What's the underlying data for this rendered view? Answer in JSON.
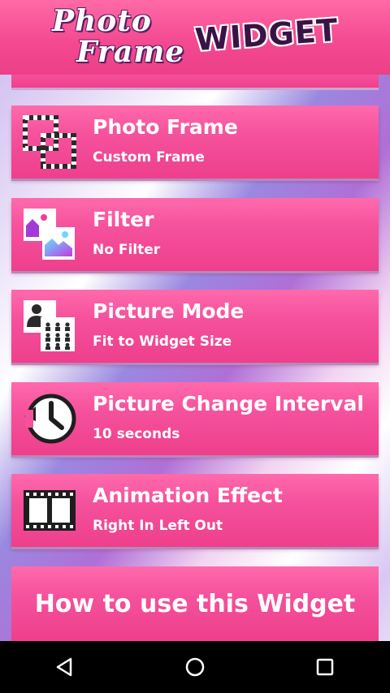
{
  "header": {
    "logo_line1": "Photo",
    "logo_line2": "Frame",
    "logo_word": "WIDGET"
  },
  "settings": [
    {
      "title": "Photo Frame",
      "subtitle": "Custom Frame",
      "icon": "photo-frame-icon"
    },
    {
      "title": "Filter",
      "subtitle": "No Filter",
      "icon": "filter-icon"
    },
    {
      "title": "Picture Mode",
      "subtitle": "Fit to Widget Size",
      "icon": "picture-mode-icon"
    },
    {
      "title": "Picture Change Interval",
      "subtitle": "10 seconds",
      "icon": "clock-icon"
    },
    {
      "title": "Animation Effect",
      "subtitle": "Right In Left Out",
      "icon": "film-strip-icon"
    }
  ],
  "help": {
    "label": "How to use this Widget"
  },
  "navbar": {
    "back": "back-icon",
    "home": "home-icon",
    "recents": "recents-icon"
  },
  "colors": {
    "card_pink": "#f5519c",
    "header_pink": "#f44a92",
    "nav_bg": "#000000"
  }
}
